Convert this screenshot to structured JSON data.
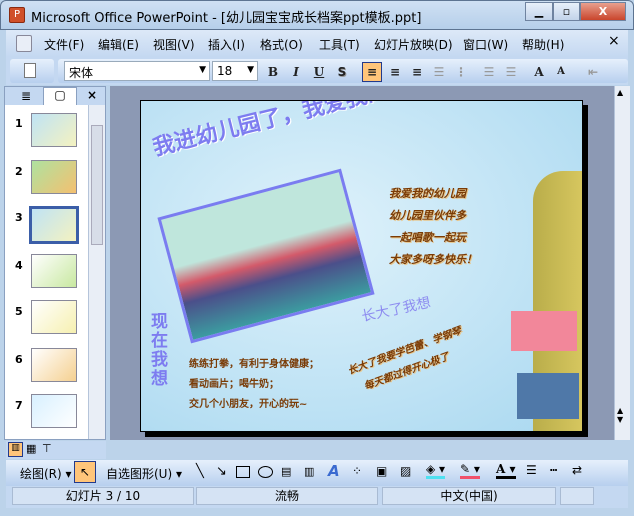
{
  "window": {
    "title": "Microsoft Office PowerPoint - [幼儿园宝宝成长档案ppt模板.ppt]",
    "minimize": "▁",
    "restore": "▫",
    "close": "X"
  },
  "menu": [
    "文件(F)",
    "编辑(E)",
    "视图(V)",
    "插入(I)",
    "格式(O)",
    "工具(T)",
    "幻灯片放映(D)",
    "窗口(W)",
    "帮助(H)"
  ],
  "menu_close": "×",
  "format": {
    "font": "宋体",
    "size": "18",
    "bold": "B",
    "italic": "I",
    "underline": "U",
    "shadow": "S"
  },
  "pane": {
    "close": "×",
    "slides": [
      "1",
      "2",
      "3",
      "4",
      "5",
      "6",
      "7"
    ],
    "selected": "3"
  },
  "slide": {
    "title": "我进幼儿园了，我爱我的幼儿园",
    "poem": [
      "我爱我的幼儿园",
      "幼儿园里伙伴多",
      "一起唱歌一起玩",
      "大家多呀多快乐！"
    ],
    "now_label": "现在我想",
    "now_lines": [
      "练练打拳，有利于身体健康；",
      "看动画片；喝牛奶；",
      "交几个小朋友，开心的玩~"
    ],
    "grow_label": "长大了我想",
    "grow_lines": [
      "长大了我要学芭蕾、学钢琴",
      "每天都过得开心极了"
    ]
  },
  "drawbar": {
    "draw": "绘图(R)",
    "autoshapes": "自选图形(U)"
  },
  "status": {
    "slide": "幻灯片 3 / 10",
    "design": "流畅",
    "language": "中文(中国)"
  },
  "colors": {
    "fill": "#4fe0f0",
    "line": "#f0506a",
    "font": "#000000"
  }
}
